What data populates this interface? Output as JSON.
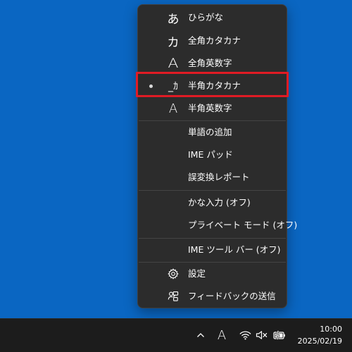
{
  "menu": {
    "items": [
      {
        "glyph": "あ",
        "label": "ひらがな",
        "selected": false
      },
      {
        "glyph": "カ",
        "label": "全角カタカナ",
        "selected": false
      },
      {
        "glyph": "A",
        "label": "全角英数字",
        "selected": false
      },
      {
        "glyph": "_ｶ",
        "label": "半角カタカナ",
        "selected": true
      },
      {
        "glyph": "A",
        "label": "半角英数字",
        "selected": false
      },
      {
        "label": "単語の追加"
      },
      {
        "label": "IME パッド"
      },
      {
        "label": "誤変換レポート"
      },
      {
        "label": "かな入力 (オフ)"
      },
      {
        "label": "プライベート モード (オフ)"
      },
      {
        "label": "IME ツール バー (オフ)"
      },
      {
        "label": "設定",
        "icon": "gear-icon"
      },
      {
        "label": "フィードバックの送信",
        "icon": "feedback-icon"
      }
    ]
  },
  "tray": {
    "ime_indicator": "A",
    "chevron_icon": "chevron-up-icon",
    "wifi_icon": "wifi-icon",
    "volume_icon": "volume-muted-icon",
    "battery_icon": "battery-charging-icon"
  },
  "clock": {
    "time": "10:00",
    "date": "2025/02/19"
  },
  "colors": {
    "desktop": "#0a66c2",
    "menu_bg": "#2c2c2c",
    "highlight": "#e01b24",
    "taskbar": "#1c1c1c"
  }
}
